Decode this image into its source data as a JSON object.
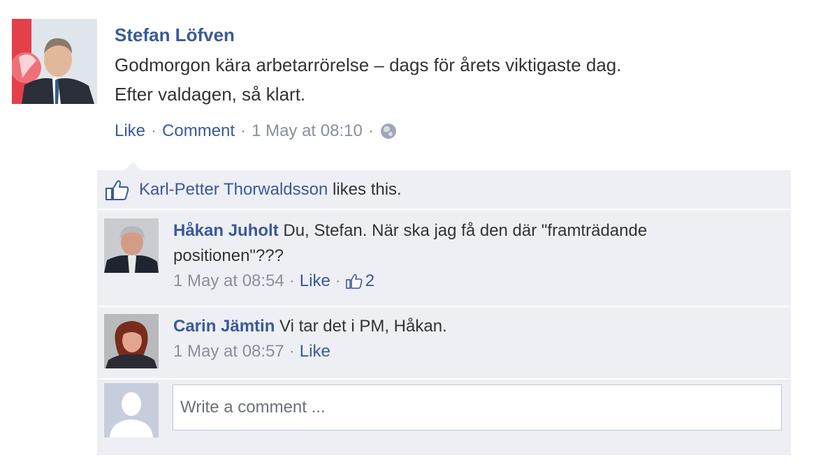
{
  "post": {
    "author": "Stefan Löfven",
    "text_line1": "Godmorgon kära arbetarrörelse – dags för årets viktigaste dag.",
    "text_line2": "Efter valdagen, så klart.",
    "like_label": "Like",
    "comment_label": "Comment",
    "timestamp": "1 May at 08:10",
    "privacy_icon": "globe-icon"
  },
  "likes": {
    "name": "Karl-Petter Thorwaldsson",
    "suffix": "likes this."
  },
  "comments": [
    {
      "author": "Håkan Juholt",
      "text_part1": "Du, Stefan. När ska jag få den där \"framträdande",
      "text_part2": "positionen\"???",
      "timestamp": "1 May at 08:54",
      "like_label": "Like",
      "like_count": "2"
    },
    {
      "author": "Carin Jämtin",
      "text": "Vi tar det i PM, Håkan.",
      "timestamp": "1 May at 08:57",
      "like_label": "Like"
    }
  ],
  "write_comment": {
    "placeholder": "Write a comment ..."
  },
  "colors": {
    "link": "#3b5998",
    "muted": "#898f9c",
    "ufi_background": "#edeff4"
  }
}
